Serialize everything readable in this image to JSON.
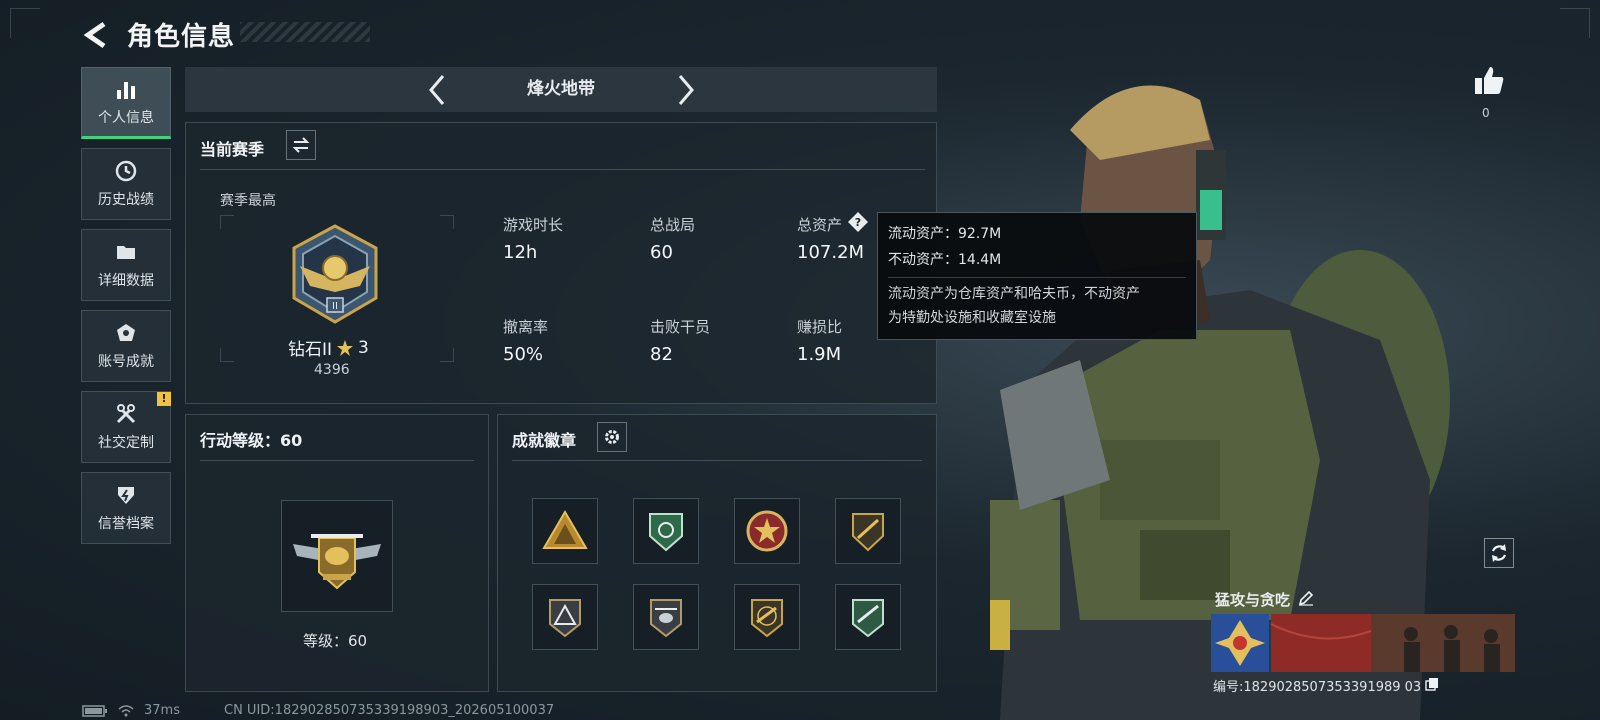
{
  "header": {
    "title": "角色信息"
  },
  "nav": {
    "items": [
      {
        "label": "个人信息",
        "icon": "bar-chart-icon",
        "active": true
      },
      {
        "label": "历史战绩",
        "icon": "clock-icon"
      },
      {
        "label": "详细数据",
        "icon": "folder-icon"
      },
      {
        "label": "账号成就",
        "icon": "medal-icon"
      },
      {
        "label": "社交定制",
        "icon": "tools-icon",
        "badge": "!"
      },
      {
        "label": "信誉档案",
        "icon": "shield-icon"
      }
    ]
  },
  "mode_selector": {
    "name": "烽火地带"
  },
  "season": {
    "title": "当前赛季",
    "best_label": "赛季最高",
    "rank_name": "钻石II",
    "rank_stars": "3",
    "rank_points": "4396",
    "stats": [
      {
        "label": "游戏时长",
        "value": "12h"
      },
      {
        "label": "总战局",
        "value": "60"
      },
      {
        "label": "总资产",
        "value": "107.2M"
      },
      {
        "label": "撤离率",
        "value": "50%"
      },
      {
        "label": "击败干员",
        "value": "82"
      },
      {
        "label": "赚损比",
        "value": "1.9M"
      }
    ]
  },
  "tooltip": {
    "line1": "流动资产：92.7M",
    "line2": "不动资产：14.4M",
    "desc1": "流动资产为仓库资产和哈夫币，不动资产",
    "desc2": "为特勤处设施和收藏室设施"
  },
  "action_level": {
    "title": "行动等级：60",
    "level_label": "等级：60"
  },
  "achievements": {
    "title": "成就徽章",
    "badges": [
      "mountain-badge-icon",
      "green-shield-badge-icon",
      "red-star-badge-icon",
      "rifle-badge-icon",
      "triangle-badge-icon",
      "helicopter-badge-icon",
      "gun-badge-icon",
      "green-rifle-badge-icon"
    ]
  },
  "social": {
    "like_count": "0"
  },
  "name_card": {
    "name": "猛攻与贪吃",
    "id_text": "编号:1829028507353391989 03"
  },
  "footer": {
    "ping": "37ms",
    "uid": "CN UID:182902850735339198903_202605100037"
  },
  "colors": {
    "accent_green": "#3fd27f",
    "warning_yellow": "#f0c43a"
  }
}
